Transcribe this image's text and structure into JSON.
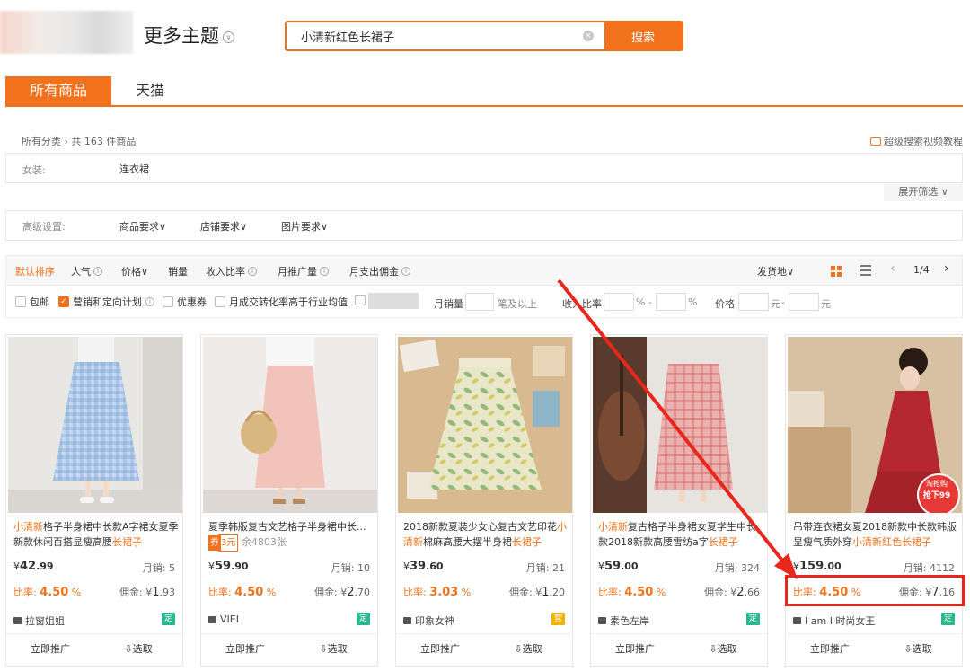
{
  "header": {
    "theme_title": "更多主题",
    "search_value": "小清新红色长裙子",
    "search_button": "搜索"
  },
  "tabs": [
    {
      "label": "所有商品"
    },
    {
      "label": "天猫"
    }
  ],
  "breadcrumb": "所有分类 › 共 163 件商品",
  "video_link": "超级搜索视频教程",
  "category": {
    "label": "女装:",
    "value": "连衣裙"
  },
  "expand_filter": "展开筛选 ∨",
  "advanced": {
    "label": "高级设置:",
    "items": [
      "商品要求∨",
      "店铺要求∨",
      "图片要求∨"
    ]
  },
  "sort": {
    "items": [
      "默认排序",
      "人气",
      "价格∨",
      "销量",
      "收入比率",
      "月推广量",
      "月支出佣金"
    ],
    "ship_from": "发货地∨",
    "page": "1/4"
  },
  "filters": {
    "checkboxes": [
      "包邮",
      "营销和定向计划",
      "优惠券",
      "月成交转化率高于行业均值"
    ],
    "monthly_sales": "月销量",
    "sales_suffix": "笔及以上",
    "rate_label": "收入比率",
    "percent": "%",
    "dash": "-",
    "price_label": "价格",
    "yuan": "元"
  },
  "labels": {
    "monthly": "月销:",
    "rate": "比率:",
    "commission": "佣金:",
    "promote": "立即推广",
    "select": "⇩选取",
    "yen": "¥"
  },
  "products": [
    {
      "title_hl1": "小清新",
      "title_mid": "格子半身裙中长款A字裙女夏季新款休闲百搭显瘦高腰",
      "title_hl2": "长裙子",
      "price_int": "42",
      "price_dec": ".99",
      "monthly": "5",
      "rate": "4.50",
      "commission_int": "1",
      "commission_dec": ".93",
      "shop": "拉窗姐姐",
      "badge": "定",
      "badge_color": "#2bb88f"
    },
    {
      "title_mid": "夏季韩版复古文艺格子半身裙中长...",
      "coupon": "券",
      "coupon_value": "3元",
      "remaining": "余4803张",
      "price_int": "59",
      "price_dec": ".90",
      "monthly": "10",
      "rate": "4.50",
      "commission_int": "2",
      "commission_dec": ".70",
      "shop": "VIEI",
      "badge": "定",
      "badge_color": "#2bb88f"
    },
    {
      "title_pre": "2018新款夏装少女心复古文艺印花",
      "title_hl1": "小清新",
      "title_mid": "棉麻高腰大摆半身裙",
      "title_hl2": "长裙子",
      "price_int": "39",
      "price_dec": ".60",
      "monthly": "21",
      "rate": "3.03",
      "commission_int": "1",
      "commission_dec": ".20",
      "shop": "印象女神",
      "badge": "营",
      "badge_color": "#f0b400"
    },
    {
      "title_hl1": "小清新",
      "title_mid": "复古格子半身裙女夏学生中长款2018新款高腰雪纺a字",
      "title_hl2": "长裙子",
      "price_int": "59",
      "price_dec": ".00",
      "monthly": "324",
      "rate": "4.50",
      "commission_int": "2",
      "commission_dec": ".66",
      "shop": "素色左岸",
      "badge": "定",
      "badge_color": "#2bb88f"
    },
    {
      "title_pre": "吊带连衣裙女夏2018新款中长款韩版显瘦气质外穿",
      "title_hl1": "小清新红色长裙子",
      "price_int": "159",
      "price_dec": ".00",
      "monthly": "4112",
      "rate": "4.50",
      "commission_int": "7",
      "commission_dec": ".16",
      "shop": "I am I 时尚女王",
      "badge": "定",
      "badge_color": "#2bb88f",
      "promo_top": "淘抢购",
      "promo_bottom": "抢下99"
    }
  ],
  "colors": {
    "accent": "#f2711c",
    "highlight_box": "#e8271d",
    "arrow": "#e8271d"
  }
}
